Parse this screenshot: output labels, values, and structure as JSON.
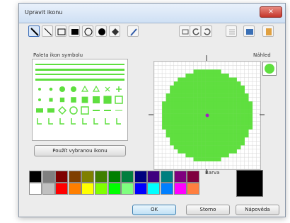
{
  "dialog": {
    "title": "Upravit ikonu",
    "close_glyph": "✕"
  },
  "toolbar": {
    "tools": [
      {
        "name": "line-tool",
        "selected": true
      },
      {
        "name": "diagonal-line-tool",
        "selected": false
      },
      {
        "name": "rectangle-tool",
        "selected": false
      },
      {
        "name": "filled-rectangle-tool",
        "selected": false
      },
      {
        "name": "circle-tool",
        "selected": false
      },
      {
        "name": "filled-circle-tool",
        "selected": false
      },
      {
        "name": "fill-tool",
        "selected": false
      },
      {
        "name": "eyedropper-tool",
        "selected": false
      }
    ],
    "actions": [
      "clear-icon",
      "rotate-left-icon",
      "rotate-right-icon",
      "mirror-icon",
      "load-icon",
      "save-icon"
    ]
  },
  "palette": {
    "label": "Paleta ikon symbolu",
    "use_button": "Použít vybranou ikonu"
  },
  "preview": {
    "label": "Náhled",
    "color": "#5fdf3f"
  },
  "color": {
    "label": "Barva",
    "selected": "#000000"
  },
  "colors": {
    "row1": [
      "#000000",
      "#7f7f7f",
      "#7f0000",
      "#7f3f00",
      "#7f7f00",
      "#3f7f00",
      "#007f00",
      "#007f3f",
      "#00007f",
      "#3f007f",
      "#007f7f",
      "#7f007f",
      "#7f003f"
    ],
    "row2": [
      "#ffffff",
      "#c0c0c0",
      "#ff0000",
      "#ff7f00",
      "#ffff00",
      "#7fff00",
      "#00ff00",
      "#7fff7f",
      "#0000ff",
      "#00ffff",
      "#007fff",
      "#ff00ff",
      "#ff7f3f"
    ]
  },
  "buttons": {
    "ok": "OK",
    "cancel": "Storno",
    "help": "Nápověda"
  }
}
